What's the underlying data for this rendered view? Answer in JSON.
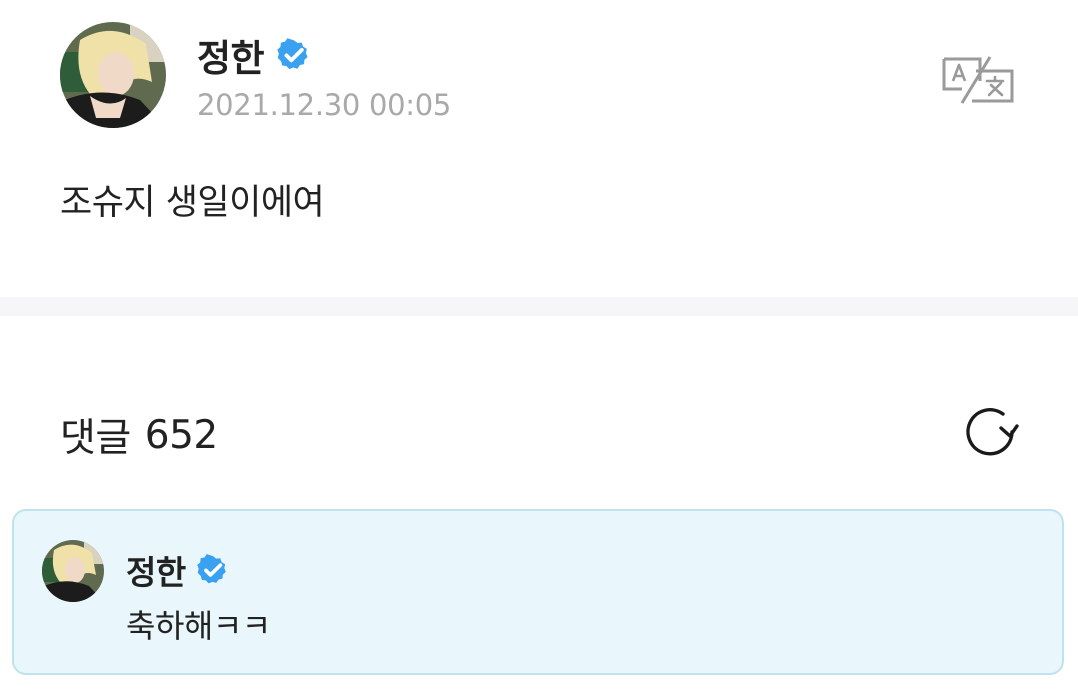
{
  "post": {
    "author": "정한",
    "date": "2021.12.30 00:05",
    "body": "조슈지 생일이에여",
    "avatar_icon": "profile-photo",
    "verified_icon": "verified-check-icon",
    "translate_icon": "translate-icon"
  },
  "comments": {
    "label": "댓글",
    "count": "652",
    "refresh_icon": "refresh-icon"
  },
  "highlighted_comment": {
    "author": "정한",
    "text": "축하해ㅋㅋ",
    "avatar_icon": "profile-photo",
    "verified_icon": "verified-check-icon"
  },
  "colors": {
    "verified_blue": "#3aa0f0",
    "date_gray": "#a9a9a9",
    "card_background": "#e9f7fd",
    "card_border": "#bfe2ef",
    "divider": "#f6f6f8"
  }
}
